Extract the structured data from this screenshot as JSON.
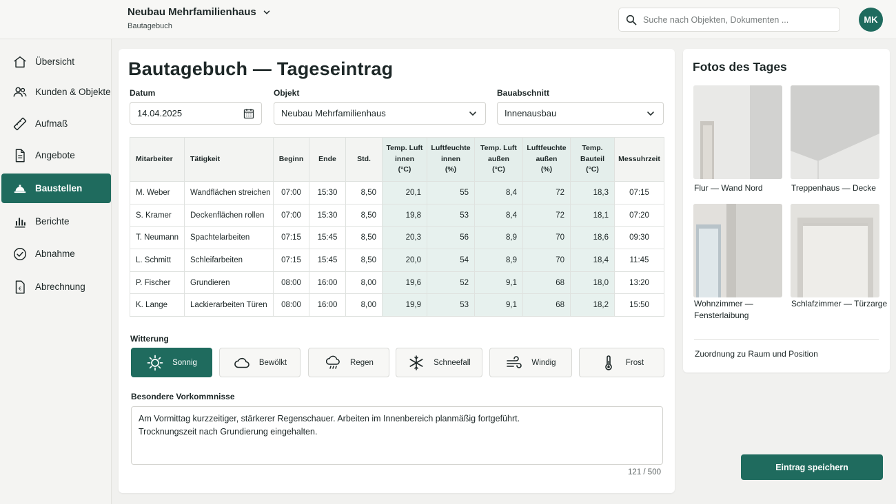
{
  "header": {
    "project_title": "Neubau Mehrfamilienhaus",
    "project_subtitle": "Bautagebuch",
    "search_placeholder": "Suche nach Objekten, Dokumenten ...",
    "avatar_initials": "MK"
  },
  "sidebar": {
    "items": [
      {
        "label": "Übersicht",
        "icon": "home-icon"
      },
      {
        "label": "Kunden & Objekte",
        "icon": "users-icon"
      },
      {
        "label": "Aufmaß",
        "icon": "ruler-icon"
      },
      {
        "label": "Angebote",
        "icon": "document-icon"
      },
      {
        "label": "Baustellen",
        "icon": "construction-icon",
        "active": true
      },
      {
        "label": "Berichte",
        "icon": "bar-chart-icon"
      },
      {
        "label": "Abnahme",
        "icon": "check-circle-icon"
      },
      {
        "label": "Abrechnung",
        "icon": "invoice-icon"
      }
    ]
  },
  "main": {
    "title": "Bautagebuch — Tageseintrag",
    "date_label": "Datum",
    "date_value": "14.04.2025",
    "object_label": "Objekt",
    "object_value": "Neubau Mehrfamilienhaus",
    "section_label": "Bauabschnitt",
    "section_value": "Innenausbau"
  },
  "table": {
    "headers": [
      "Mitarbeiter",
      "Tätigkeit",
      "Beginn",
      "Ende",
      "Std.",
      "Temp. Luft\ninnen\n(°C)",
      "Luftfeuchte\ninnen\n(%)",
      "Temp. Luft\naußen\n(°C)",
      "Luftfeuchte\naußen\n(%)",
      "Temp.\nBauteil\n(°C)",
      "Messuhrzeit"
    ],
    "rows": [
      [
        "M. Weber",
        "Wandflächen streichen",
        "07:00",
        "15:30",
        "8,50",
        "20,1",
        "55",
        "8,4",
        "72",
        "18,3",
        "07:15"
      ],
      [
        "S. Kramer",
        "Deckenflächen rollen",
        "07:00",
        "15:30",
        "8,50",
        "19,8",
        "53",
        "8,4",
        "72",
        "18,1",
        "07:20"
      ],
      [
        "T. Neumann",
        "Spachtelarbeiten",
        "07:15",
        "15:45",
        "8,50",
        "20,3",
        "56",
        "8,9",
        "70",
        "18,6",
        "09:30"
      ],
      [
        "L. Schmitt",
        "Schleifarbeiten",
        "07:15",
        "15:45",
        "8,50",
        "20,0",
        "54",
        "8,9",
        "70",
        "18,4",
        "11:45"
      ],
      [
        "P. Fischer",
        "Grundieren",
        "08:00",
        "16:00",
        "8,00",
        "19,6",
        "52",
        "9,1",
        "68",
        "18,0",
        "13:20"
      ],
      [
        "K. Lange",
        "Lackierarbeiten Türen",
        "08:00",
        "16:00",
        "8,00",
        "19,9",
        "53",
        "9,1",
        "68",
        "18,2",
        "15:50"
      ]
    ]
  },
  "weather": {
    "label": "Witterung",
    "options": [
      {
        "label": "Sonnig",
        "icon": "sun-icon",
        "active": true
      },
      {
        "label": "Bewölkt",
        "icon": "cloud-icon"
      },
      {
        "label": "Regen",
        "icon": "rain-icon"
      },
      {
        "label": "Schneefall",
        "icon": "snowflake-icon"
      },
      {
        "label": "Windig",
        "icon": "wind-icon"
      },
      {
        "label": "Frost",
        "icon": "thermometer-icon"
      }
    ]
  },
  "notes": {
    "label": "Besondere Vorkommnisse",
    "value": "Am Vormittag kurzzeitiger, stärkerer Regenschauer. Arbeiten im Innenbereich planmäßig fortgeführt.\nTrocknungszeit nach Grundierung eingehalten.",
    "counter": "121 / 500"
  },
  "photos": {
    "title": "Fotos des Tages",
    "items": [
      {
        "caption": "Flur — Wand Nord"
      },
      {
        "caption": "Treppenhaus — Decke"
      },
      {
        "caption": "Wohnzimmer —\nFensterlaibung"
      },
      {
        "caption": "Schlafzimmer — Türzarge"
      }
    ],
    "assign_label": "Zuordnung zu Raum und Position"
  },
  "actions": {
    "save_label": "Eintrag speichern"
  },
  "colors": {
    "accent": "#1f6b5e",
    "highlight_columns": "#e7f1ee"
  }
}
